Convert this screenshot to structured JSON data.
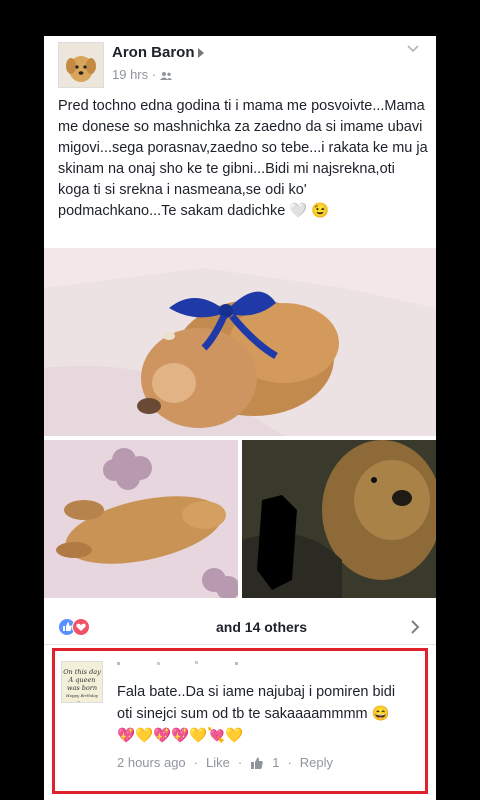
{
  "post": {
    "author": "Aron Baron",
    "time": "19 hrs",
    "separator": "·",
    "text": "Pred tochno edna godina ti i mama me posvoivte...Mama me donese so mashnichka za zaedno da si imame ubavi migovi...sega porasnav,zaedno so tebe...i rakata ke mu ja skinam na onaj sho ke te gibni...Bidi mi najsrekna,oti koga ti si srekna i nasmeana,se odi ko' podmachkano...Te sakam dadichke",
    "text_emoji": "🤍 😉"
  },
  "reactions": {
    "others_text": "and 14 others"
  },
  "comment": {
    "avatar_text": [
      "On this day",
      "A queen",
      "was born",
      "Happy Birthday Dear"
    ],
    "text": "Fala bate..Da si iame najubaj i pomiren bidi oti sinejci sum od tb te sakaaaammmm",
    "time": "2 hours ago",
    "like_label": "Like",
    "like_count": "1",
    "reply_label": "Reply",
    "dot": "·"
  },
  "colors": {
    "highlight_border": "#e0202a",
    "like_blue": "#5890ff",
    "love_red": "#f25268",
    "meta_gray": "#90949c"
  }
}
